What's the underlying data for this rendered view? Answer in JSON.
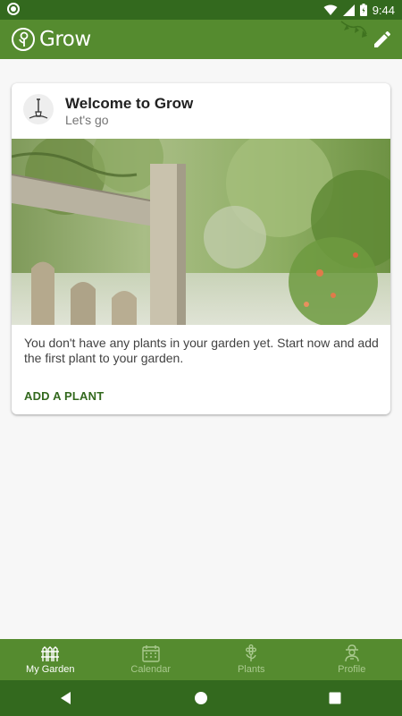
{
  "status_bar": {
    "time": "9:44"
  },
  "app_bar": {
    "title": "Grow"
  },
  "card": {
    "title": "Welcome to Grow",
    "subtitle": "Let's go",
    "body": "You don't have any plants in your garden yet. Start now and add the first plant to your garden.",
    "action_label": "ADD A PLANT"
  },
  "bottom_nav": {
    "items": [
      {
        "label": "My Garden",
        "icon": "fence-icon",
        "active": true
      },
      {
        "label": "Calendar",
        "icon": "calendar-icon",
        "active": false
      },
      {
        "label": "Plants",
        "icon": "flower-icon",
        "active": false
      },
      {
        "label": "Profile",
        "icon": "gardener-icon",
        "active": false
      }
    ]
  },
  "colors": {
    "primary": "#558b2f",
    "primary_dark": "#33691e",
    "accent_text": "#33691e"
  }
}
